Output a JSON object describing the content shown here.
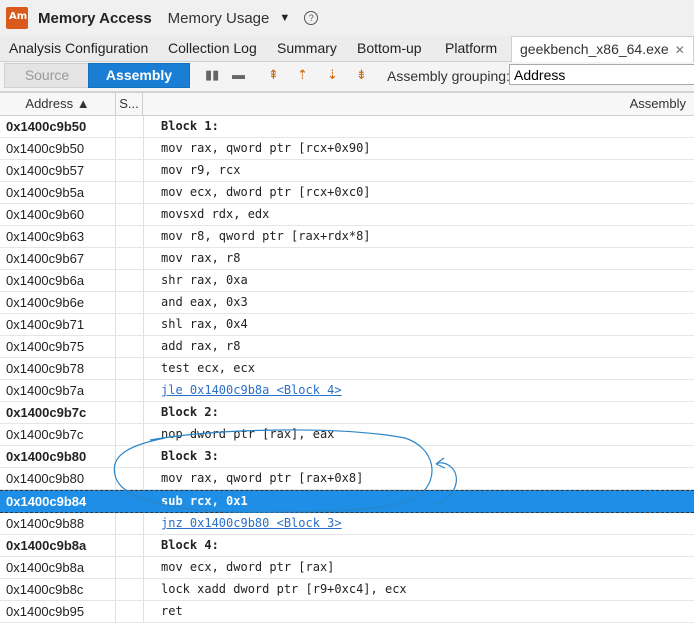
{
  "app": {
    "title": "Memory Access",
    "view": "Memory Usage",
    "help": "?"
  },
  "tabs": [
    {
      "label": "Analysis Configuration"
    },
    {
      "label": "Collection Log"
    },
    {
      "label": "Summary"
    },
    {
      "label": "Bottom-up"
    },
    {
      "label": "Platform"
    },
    {
      "label": "geekbench_x86_64.exe",
      "close": "✕"
    }
  ],
  "toolbar": {
    "source_label": "Source",
    "assembly_label": "Assembly",
    "grouping_label": "Assembly grouping:",
    "grouping_value": "Address"
  },
  "grid": {
    "headers": {
      "address": "Address ▲",
      "source": "S...",
      "assembly": "Assembly"
    },
    "rows": [
      {
        "address": "0x1400c9b50",
        "code": "Block 1:"
      },
      {
        "address": "0x1400c9b50",
        "code": "mov rax, qword ptr [rcx+0x90]"
      },
      {
        "address": "0x1400c9b57",
        "code": "mov r9, rcx"
      },
      {
        "address": "0x1400c9b5a",
        "code": "mov ecx, dword ptr [rcx+0xc0]"
      },
      {
        "address": "0x1400c9b60",
        "code": "movsxd rdx, edx"
      },
      {
        "address": "0x1400c9b63",
        "code": "mov r8, qword ptr [rax+rdx*8]"
      },
      {
        "address": "0x1400c9b67",
        "code": "mov rax, r8"
      },
      {
        "address": "0x1400c9b6a",
        "code": "shr rax, 0xa"
      },
      {
        "address": "0x1400c9b6e",
        "code": "and eax, 0x3"
      },
      {
        "address": "0x1400c9b71",
        "code": "shl rax, 0x4"
      },
      {
        "address": "0x1400c9b75",
        "code": "add rax, r8"
      },
      {
        "address": "0x1400c9b78",
        "code": "test ecx, ecx"
      },
      {
        "address": "0x1400c9b7a",
        "code": "jle 0x1400c9b8a <Block 4>"
      },
      {
        "address": "0x1400c9b7c",
        "code": "Block 2:"
      },
      {
        "address": "0x1400c9b7c",
        "code": "nop dword ptr [rax], eax"
      },
      {
        "address": "0x1400c9b80",
        "code": "Block 3:"
      },
      {
        "address": "0x1400c9b80",
        "code": "mov rax, qword ptr [rax+0x8]"
      },
      {
        "address": "0x1400c9b84",
        "code": "sub rcx, 0x1"
      },
      {
        "address": "0x1400c9b88",
        "code": "jnz 0x1400c9b80 <Block 3>"
      },
      {
        "address": "0x1400c9b8a",
        "code": "Block 4:"
      },
      {
        "address": "0x1400c9b8a",
        "code": "mov ecx, dword ptr [rax]"
      },
      {
        "address": "0x1400c9b8c",
        "code": "lock xadd dword ptr [r9+0xc4], ecx"
      },
      {
        "address": "0x1400c9b95",
        "code": "ret"
      }
    ]
  },
  "colors": {
    "accent": "#1a7fd4",
    "selection": "#1e8ee6",
    "link": "#2a6fc9",
    "annotation": "#2b86c8"
  }
}
